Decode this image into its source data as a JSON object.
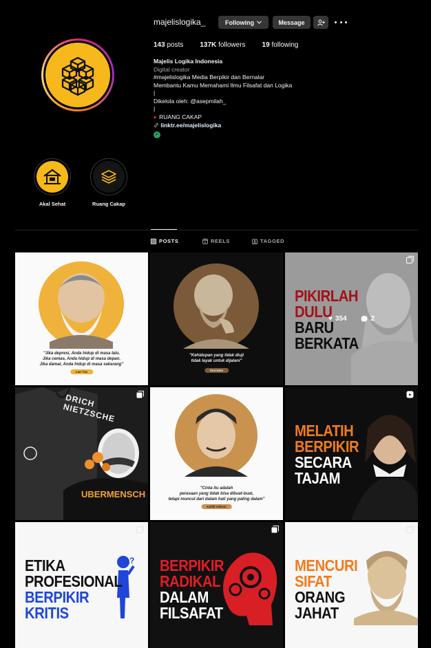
{
  "profile": {
    "username": "majelislogika_",
    "buttons": {
      "following": "Following",
      "message": "Message"
    },
    "stats": [
      {
        "value": "143",
        "label": "posts"
      },
      {
        "value": "137K",
        "label": "followers"
      },
      {
        "value": "19",
        "label": "following"
      }
    ],
    "bio": {
      "name": "Majelis Logika Indonesia",
      "category": "Digital creator",
      "lines": [
        "#majelislogika Media Berpikir dan Bernalar",
        "Membantu Kamu Memahami Ilmu Filsafat dan Logika",
        "|",
        "Dikelola oleh: @asepmilah_",
        "|",
        "RUANG CAKAP"
      ],
      "link": "linktr.ee/majelislogika"
    },
    "colors": {
      "accent": "#f6b81a",
      "link": "#e0f1ff",
      "button": "#363636"
    }
  },
  "highlights": [
    {
      "label": "Akal Sehat",
      "icon": "house-icon"
    },
    {
      "label": "Ruang Cakap",
      "icon": "stack-icon"
    }
  ],
  "tabs": [
    {
      "label": "POSTS",
      "icon": "grid-icon",
      "active": true
    },
    {
      "label": "REELS",
      "icon": "reels-icon",
      "active": false
    },
    {
      "label": "TAGGED",
      "icon": "tagged-icon",
      "active": false
    }
  ],
  "posts": [
    {
      "type": "quote",
      "caption": [
        "\"Jika depresi, Anda hidup di masa lalu.",
        "Jika cemas, Anda hidup di masa depan.",
        "Jika damai, Anda hidup di masa sekarang\""
      ],
      "author": "Lao Tzu"
    },
    {
      "type": "quote",
      "caption": [
        "\"Kehidupan yang tidak diuji",
        "tidak layak untuk dijalani\""
      ],
      "author": "Socrates"
    },
    {
      "type": "headline",
      "lines": [
        "PIKIRLAH",
        "DULU",
        "BARU",
        "BERKATA"
      ],
      "likes": "354",
      "comments": "2"
    },
    {
      "type": "tshirt",
      "headline": "DRICH NIETZSCHE",
      "sub": "UBERMENSCH"
    },
    {
      "type": "quote",
      "caption": [
        "\"Cinta itu adalah",
        "perasaan yang tidak bisa dibuat-buat,",
        "tetapi muncul dari dalam hati yang paling dalam\""
      ],
      "author": "Kahlil Gibran"
    },
    {
      "type": "headline",
      "lines": [
        "MELATIH",
        "BERPIKIR",
        "SECARA",
        "TAJAM"
      ]
    },
    {
      "type": "headline",
      "lines": [
        "ETIKA",
        "PROFESIONAL",
        "BERPIKIR",
        "KRITIS"
      ]
    },
    {
      "type": "headline",
      "lines": [
        "BERPIKIR",
        "RADIKAL",
        "DALAM",
        "FILSAFAT"
      ]
    },
    {
      "type": "headline",
      "lines": [
        "MENCURI",
        "SIFAT",
        "ORANG",
        "JAHAT"
      ]
    }
  ]
}
